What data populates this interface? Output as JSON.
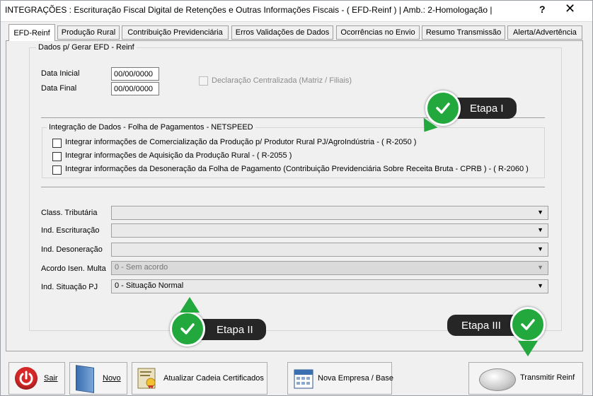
{
  "window": {
    "title": "INTEGRAÇÕES : Escrituração Fiscal Digital de Retenções e Outras Informações Fiscais - ( EFD-Reinf )  | Amb.: 2-Homologação |",
    "help": "?",
    "close": "✕"
  },
  "tabs": [
    {
      "label": "EFD-Reinf",
      "active": true
    },
    {
      "label": "Produção Rural"
    },
    {
      "label": "Contribuição Previdenciária"
    },
    {
      "label": "Erros Validações de Dados"
    },
    {
      "label": "Ocorrências no Envio"
    },
    {
      "label": "Resumo Transmissão"
    },
    {
      "label": "Alerta/Advertência"
    }
  ],
  "form": {
    "group_title": "Dados p/ Gerar EFD - Reinf",
    "data_inicial_label": "Data Inicial",
    "data_inicial_value": "00/00/0000",
    "data_final_label": "Data Final",
    "data_final_value": "00/00/0000",
    "declaracao_label": "Declaração Centralizada (Matriz / Filiais)",
    "integracao_title": "Integração de Dados - Folha de Pagamentos - NETSPEED",
    "integracao_items": [
      "Integrar informações de Comercialização da Produção p/ Produtor Rural PJ/AgroIndústria - ( R-2050 )",
      "Integrar informações de Aquisição da Produção Rural - ( R-2055 )",
      "Integrar informações da Desoneração da Folha de Pagamento (Contribuição Previdenciária Sobre Receita Bruta - CPRB ) - ( R-2060 )"
    ],
    "class_tributaria_label": "Class. Tributária",
    "class_tributaria_value": "",
    "ind_escrituracao_label": "Ind. Escrituração",
    "ind_escrituracao_value": "",
    "ind_desoneracao_label": "Ind. Desoneração",
    "ind_desoneracao_value": "",
    "acordo_label": "Acordo Isen. Multa",
    "acordo_value": "0 - Sem acordo",
    "situacao_label": "Ind. Situação PJ",
    "situacao_value": "0 - Situação Normal"
  },
  "buttons": {
    "sair": "Sair",
    "novo": "Novo",
    "atualizar": "Atualizar Cadeia Certificados",
    "nova_empresa": "Nova Empresa / Base",
    "transmitir": "Transmitir Reinf"
  },
  "annotations": {
    "etapa1": "Etapa I",
    "etapa2": "Etapa II",
    "etapa3": "Etapa III"
  },
  "colors": {
    "badge_bg": "#262626",
    "check_green": "#22a83c"
  }
}
